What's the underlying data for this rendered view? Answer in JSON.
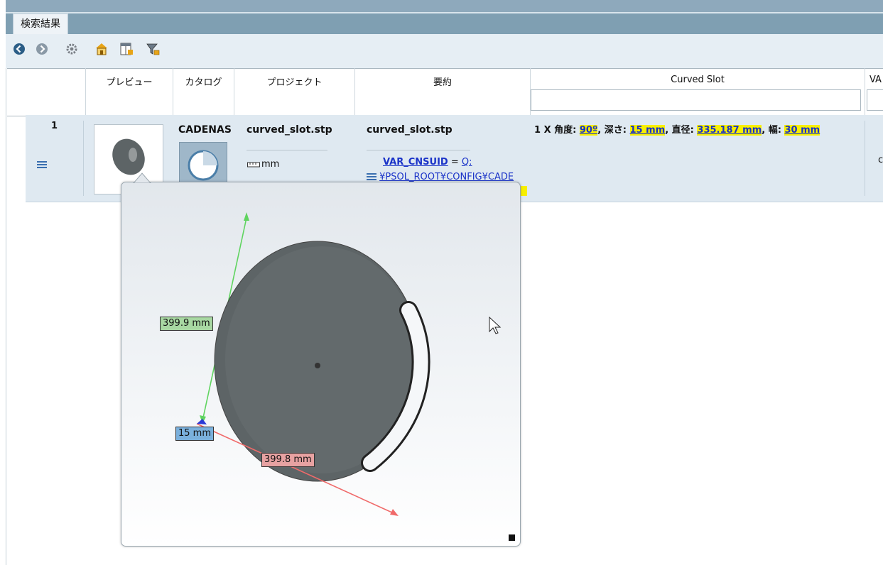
{
  "tab": {
    "label": "検索結果"
  },
  "toolbar": {
    "icons": [
      "back-icon",
      "forward-icon",
      "settings-icon",
      "catalog-home-icon",
      "column-layout-icon",
      "filter-icon"
    ]
  },
  "table": {
    "columns": [
      "プレビュー",
      "カタログ",
      "プロジェクト",
      "要約",
      "Curved Slot",
      "VA"
    ],
    "row": {
      "index": "1",
      "catalog": "CADENAS",
      "project": "curved_slot.stp",
      "unit": "mm",
      "summary_title": "curved_slot.stp",
      "var_name": "VAR_CNSUID",
      "var_eq": " = ",
      "var_value_1": "Q:",
      "var_value_2": "¥PSOL_ROOT¥CONFIG¥CADE",
      "curved_slot": {
        "prefix": "1 X 角度: ",
        "angle": "90º",
        "depth_label": ", 深さ: ",
        "depth": "15 mm",
        "diameter_label": ", 直径: ",
        "diameter": "335.187 mm",
        "width_label": ", 幅: ",
        "width": "30 mm"
      },
      "last_col_char": "c"
    }
  },
  "preview": {
    "dim_y": "399.9 mm",
    "dim_z": "15 mm",
    "dim_x": "399.8 mm",
    "colors": {
      "y_axis": "#5fd45f",
      "x_axis": "#f06a6a",
      "z_axis": "#2b3ad6",
      "disc": "#5d6466"
    }
  }
}
